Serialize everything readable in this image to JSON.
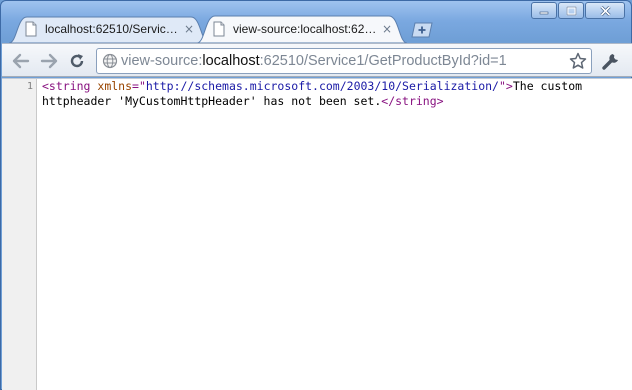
{
  "tabs": [
    {
      "title": "localhost:62510/Service1/…",
      "close": "×",
      "active": false
    },
    {
      "title": "view-source:localhost:625…",
      "close": "×",
      "active": true
    }
  ],
  "window_controls": [
    "minimize",
    "maximize",
    "close"
  ],
  "toolbar": {
    "back": "back-arrow-icon",
    "forward": "forward-arrow-icon",
    "reload": "reload-icon",
    "url_prefix": "view-source:",
    "url_host": "localhost",
    "url_rest": ":62510/Service1/GetProductById?id=1",
    "bookmark": "star-icon",
    "menu": "wrench-icon"
  },
  "source": {
    "line_number": "1",
    "tag_open": "<string ",
    "attr_name": "xmlns",
    "attr_eq": "=\"",
    "attr_value": "http://schemas.microsoft.com/2003/10/Serialization/",
    "attr_close": "\">",
    "text": "The custom httpheader 'MyCustomHttpHeader' has not been set.",
    "tag_close": "</string>"
  },
  "colors": {
    "frame": "#6f9fd6",
    "tag": "#881280",
    "attr": "#994500",
    "attr_value": "#1a1aa6"
  }
}
